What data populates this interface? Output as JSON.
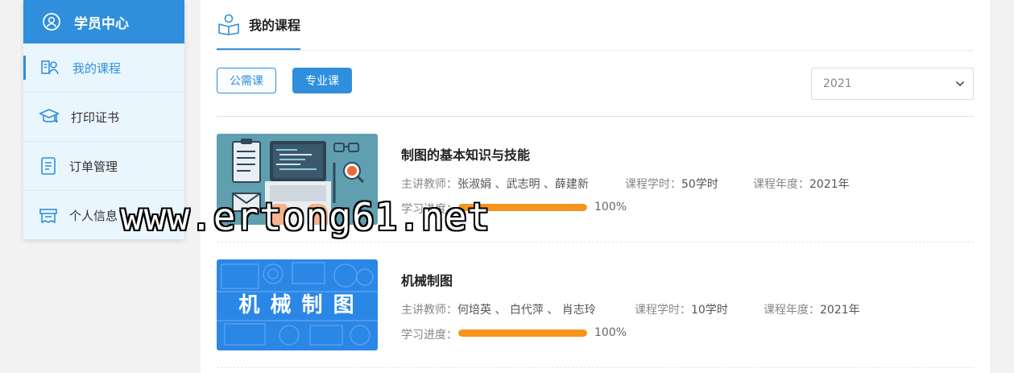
{
  "sidebar": {
    "header_title": "学员中心",
    "items": [
      {
        "label": "我的课程",
        "icon": "course-icon"
      },
      {
        "label": "打印证书",
        "icon": "graduation-cap-icon"
      },
      {
        "label": "订单管理",
        "icon": "document-icon"
      },
      {
        "label": "个人信息",
        "icon": "profile-card-icon"
      }
    ]
  },
  "main": {
    "tab_label": "我的课程",
    "filters": {
      "public": "公需课",
      "professional": "专业课"
    },
    "year_select": {
      "value": "2021"
    }
  },
  "courses": [
    {
      "title": "制图的基本知识与技能",
      "teachers_label": "主讲教师：",
      "teachers": "张淑娟 、武志明 、薛建新",
      "hours_label": "课程学时：",
      "hours": "50学时",
      "year_label": "课程年度：",
      "year": "2021年",
      "progress_label": "学习进度：",
      "progress": 100,
      "progress_text": "100%"
    },
    {
      "title": "机械制图",
      "teachers_label": "主讲教师：",
      "teachers": "何培英 、 白代萍 、 肖志玲",
      "hours_label": "课程学时：",
      "hours": "10学时",
      "year_label": "课程年度：",
      "year": "2021年",
      "progress_label": "学习进度：",
      "progress": 100,
      "progress_text": "100%",
      "thumb_text": "机 械 制 图"
    }
  ],
  "watermark": "www.ertong61.net",
  "colors": {
    "accent": "#2f8fdc",
    "progress": "#f7941d"
  }
}
